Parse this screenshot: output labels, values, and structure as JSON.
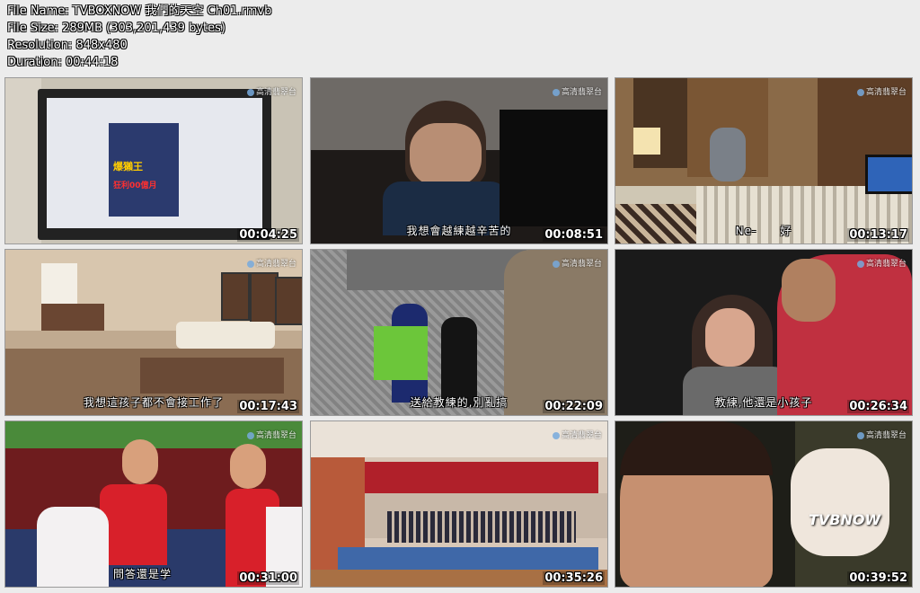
{
  "info": {
    "file_name": "File Name: TVBOXNOW 我們的天空 Ch01.rmvb",
    "file_size": "File Size: 289MB (303,201,439 bytes)",
    "resolution": "Resolution: 848x480",
    "duration": "Duration: 00:44:18"
  },
  "thumbnails": [
    {
      "time": "00:04:25",
      "subtitle": "",
      "poster_line1": "爆獺王",
      "poster_line2": "狂利00億月"
    },
    {
      "time": "00:08:51",
      "subtitle": "我想會越練越辛苦的"
    },
    {
      "time": "00:13:17",
      "subtitle": "Ne-　　好"
    },
    {
      "time": "00:17:43",
      "subtitle": "我想這孩子都不會接工作了"
    },
    {
      "time": "00:22:09",
      "subtitle": "送給教練的,別亂搞"
    },
    {
      "time": "00:26:34",
      "subtitle": "教練,他還是小孩子"
    },
    {
      "time": "00:31:00",
      "subtitle": "問答還是学"
    },
    {
      "time": "00:35:26",
      "subtitle": ""
    },
    {
      "time": "00:39:52",
      "subtitle": "",
      "watermark": "TVBNOW"
    }
  ],
  "channel_logo": "高清翡翠台"
}
